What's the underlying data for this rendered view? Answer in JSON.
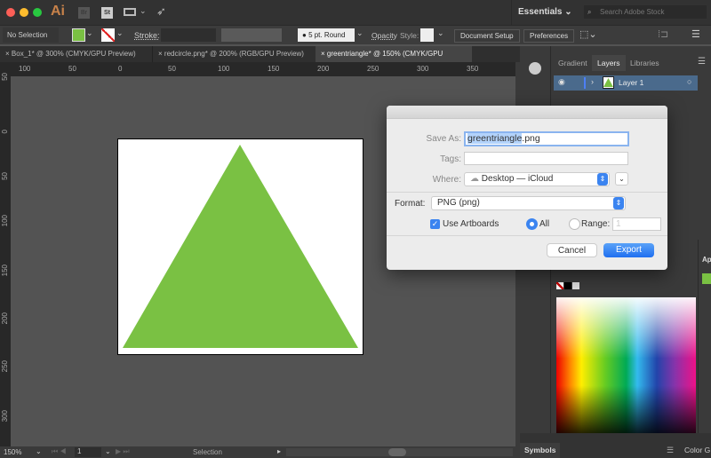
{
  "app": {
    "logo": "Ai",
    "bridge": "Br",
    "stock": "St",
    "workspace": "Essentials",
    "search_placeholder": "Search Adobe Stock"
  },
  "toolbar": {
    "selection": "No Selection",
    "stroke_label": "Stroke:",
    "brush": "5 pt. Round",
    "opacity_label": "Opacity",
    "style_label": "Style:",
    "document_setup": "Document Setup",
    "preferences": "Preferences",
    "fill_color": "#7ac143"
  },
  "tabs": [
    {
      "label": "Box_1* @ 300% (CMYK/GPU Preview)"
    },
    {
      "label": "redcircle.png* @ 200% (RGB/GPU Preview)"
    },
    {
      "label": "greentriangle* @ 150% (CMYK/GPU Preview)",
      "active": true
    }
  ],
  "ruler": {
    "h": [
      "100",
      "50",
      "0",
      "50",
      "100",
      "150",
      "200",
      "250",
      "300",
      "350"
    ],
    "v": [
      "50",
      "0",
      "50",
      "100",
      "150",
      "200",
      "250",
      "300"
    ]
  },
  "panel": {
    "tabs": [
      "Gradient",
      "Layers",
      "Libraries"
    ],
    "layer": "Layer 1",
    "appearance": "Ap"
  },
  "dialog": {
    "save_as_label": "Save As:",
    "save_as_value": "greentriangle.png",
    "save_as_selected": "greentriangle",
    "save_as_rest": ".png",
    "tags_label": "Tags:",
    "where_label": "Where:",
    "where_value": "Desktop — iCloud",
    "format_label": "Format:",
    "format_value": "PNG (png)",
    "use_artboards": "Use Artboards",
    "all": "All",
    "range": "Range:",
    "range_value": "1",
    "cancel": "Cancel",
    "export": "Export"
  },
  "status": {
    "zoom": "150%",
    "page": "1",
    "tool": "Selection"
  },
  "bottom_panels": {
    "symbols": "Symbols",
    "color_guide": "Color G"
  }
}
